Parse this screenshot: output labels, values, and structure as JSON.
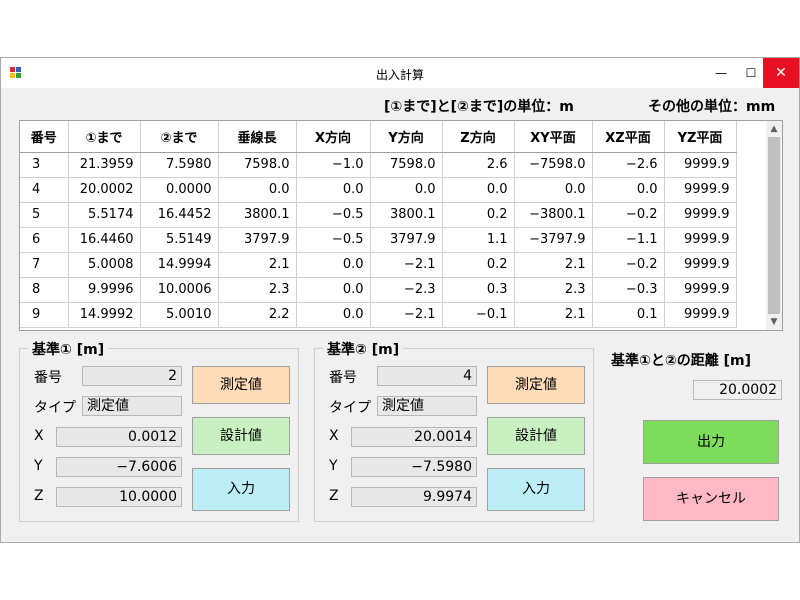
{
  "window": {
    "title": "出入計算",
    "min_glyph": "—",
    "max_glyph": "☐",
    "close_glyph": "✕"
  },
  "units": {
    "left": "[①まで]と[②まで]の単位：m",
    "right": "その他の単位：mm"
  },
  "table": {
    "headers": [
      "番号",
      "①まで",
      "②まで",
      "垂線長",
      "X方向",
      "Y方向",
      "Z方向",
      "XY平面",
      "XZ平面",
      "YZ平面"
    ],
    "rows": [
      [
        "3",
        "21.3959",
        "7.5980",
        "7598.0",
        "−1.0",
        "7598.0",
        "2.6",
        "−7598.0",
        "−2.6",
        "9999.9"
      ],
      [
        "4",
        "20.0002",
        "0.0000",
        "0.0",
        "0.0",
        "0.0",
        "0.0",
        "0.0",
        "0.0",
        "9999.9"
      ],
      [
        "5",
        "5.5174",
        "16.4452",
        "3800.1",
        "−0.5",
        "3800.1",
        "0.2",
        "−3800.1",
        "−0.2",
        "9999.9"
      ],
      [
        "6",
        "16.4460",
        "5.5149",
        "3797.9",
        "−0.5",
        "3797.9",
        "1.1",
        "−3797.9",
        "−1.1",
        "9999.9"
      ],
      [
        "7",
        "5.0008",
        "14.9994",
        "2.1",
        "0.0",
        "−2.1",
        "0.2",
        "2.1",
        "−0.2",
        "9999.9"
      ],
      [
        "8",
        "9.9996",
        "10.0006",
        "2.3",
        "0.0",
        "−2.3",
        "0.3",
        "2.3",
        "−0.3",
        "9999.9"
      ],
      [
        "9",
        "14.9992",
        "5.0010",
        "2.2",
        "0.0",
        "−2.1",
        "−0.1",
        "2.1",
        "0.1",
        "9999.9"
      ]
    ]
  },
  "ref1": {
    "title": "基準①  [m]",
    "num_label": "番号",
    "num": "2",
    "type_label": "タイプ",
    "type": "測定値",
    "x_label": "X",
    "x": "0.0012",
    "y_label": "Y",
    "y": "−7.6006",
    "z_label": "Z",
    "z": "10.0000",
    "btn_measured": "測定値",
    "btn_design": "設計値",
    "btn_input": "入力"
  },
  "ref2": {
    "title": "基準②  [m]",
    "num_label": "番号",
    "num": "4",
    "type_label": "タイプ",
    "type": "測定値",
    "x_label": "X",
    "x": "20.0014",
    "y_label": "Y",
    "y": "−7.5980",
    "z_label": "Z",
    "z": "9.9974",
    "btn_measured": "測定値",
    "btn_design": "設計値",
    "btn_input": "入力"
  },
  "distance": {
    "label": "基準①と②の距離 [m]",
    "value": "20.0002"
  },
  "actions": {
    "output": "出力",
    "cancel": "キャンセル"
  },
  "colors": {
    "measured_button": "#ffdcb8",
    "design_button": "#c8f0c0",
    "input_button": "#bdeef6",
    "output_button": "#7ddc5c",
    "cancel_button": "#ffb8c4",
    "close_button": "#e81123"
  }
}
